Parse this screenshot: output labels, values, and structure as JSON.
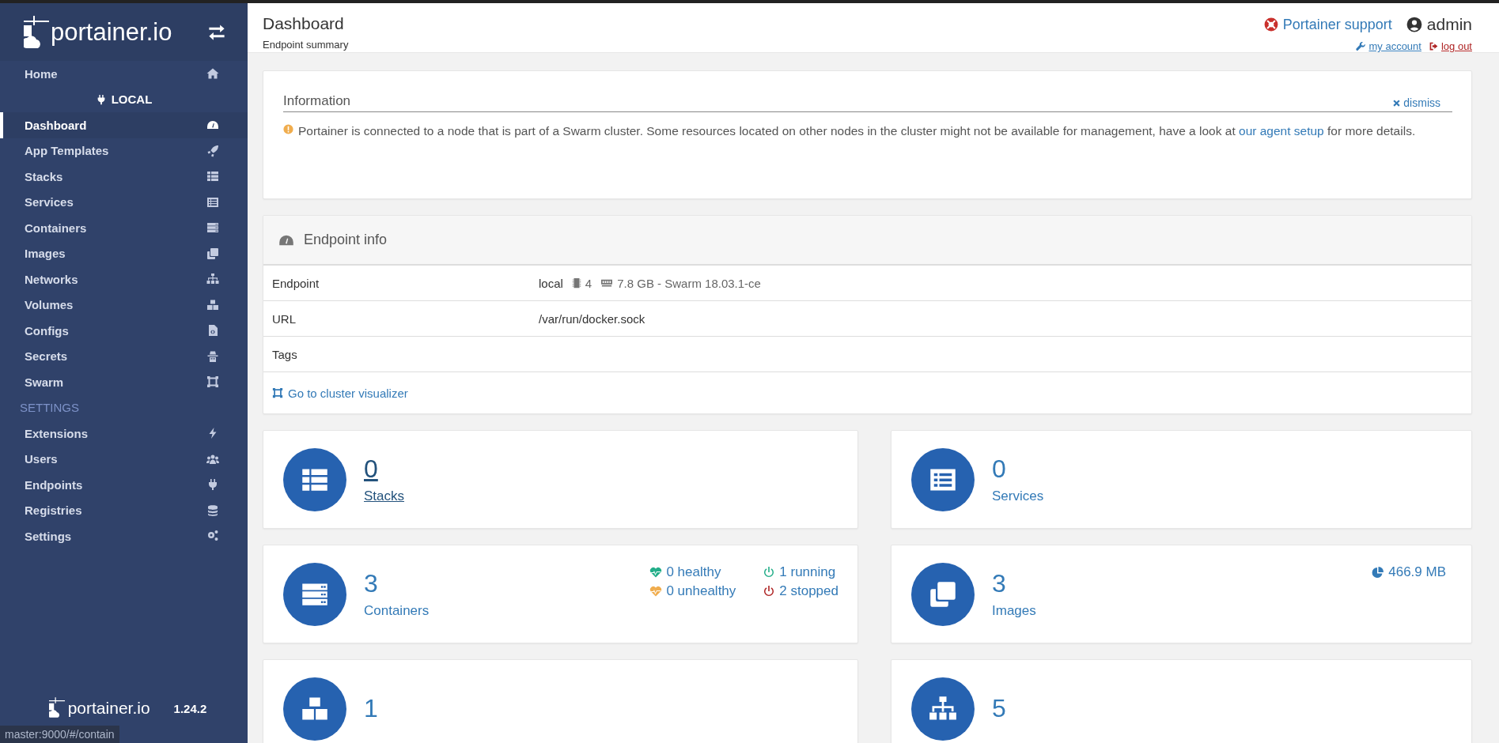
{
  "sidebar": {
    "brand": "portainer.io",
    "items": [
      {
        "kind": "link",
        "label": "Home",
        "selected": false
      },
      {
        "kind": "endpoint",
        "label": "LOCAL"
      },
      {
        "kind": "link",
        "label": "Dashboard",
        "selected": true
      },
      {
        "kind": "link",
        "label": "App Templates",
        "selected": false
      },
      {
        "kind": "link",
        "label": "Stacks",
        "selected": false
      },
      {
        "kind": "link",
        "label": "Services",
        "selected": false
      },
      {
        "kind": "link",
        "label": "Containers",
        "selected": false
      },
      {
        "kind": "link",
        "label": "Images",
        "selected": false
      },
      {
        "kind": "link",
        "label": "Networks",
        "selected": false
      },
      {
        "kind": "link",
        "label": "Volumes",
        "selected": false
      },
      {
        "kind": "link",
        "label": "Configs",
        "selected": false
      },
      {
        "kind": "link",
        "label": "Secrets",
        "selected": false
      },
      {
        "kind": "link",
        "label": "Swarm",
        "selected": false
      },
      {
        "kind": "section",
        "label": "SETTINGS"
      },
      {
        "kind": "link",
        "label": "Extensions",
        "selected": false
      },
      {
        "kind": "link",
        "label": "Users",
        "selected": false
      },
      {
        "kind": "link",
        "label": "Endpoints",
        "selected": false
      },
      {
        "kind": "link",
        "label": "Registries",
        "selected": false
      },
      {
        "kind": "link",
        "label": "Settings",
        "selected": false
      }
    ],
    "footer": {
      "brand": "portainer.io",
      "version": "1.24.2"
    }
  },
  "header": {
    "title": "Dashboard",
    "subtitle": "Endpoint summary",
    "support": "Portainer support",
    "user": "admin",
    "my_account": "my account",
    "log_out": "log out"
  },
  "information": {
    "title": "Information",
    "dismiss": "dismiss",
    "text_before": "Portainer is connected to a node that is part of a Swarm cluster. Some resources located on other nodes in the cluster might not be available for management, have a look at ",
    "link": "our agent setup",
    "text_after": " for more details."
  },
  "endpoint_info": {
    "title": "Endpoint info",
    "rows": [
      {
        "kind": "endpoint",
        "label": "Endpoint",
        "name": "local",
        "cpu": "4",
        "memory": "7.8 GB - Swarm 18.03.1-ce"
      },
      {
        "kind": "text",
        "label": "URL",
        "value": "/var/run/docker.sock"
      },
      {
        "kind": "text",
        "label": "Tags"
      }
    ],
    "link": "Go to cluster visualizer"
  },
  "stats": [
    {
      "kind": "stacks",
      "count": "0",
      "label": "Stacks",
      "hovered": true
    },
    {
      "kind": "services",
      "count": "0",
      "label": "Services",
      "hovered": false
    },
    {
      "kind": "containers",
      "count": "3",
      "label": "Containers",
      "hovered": false,
      "details": [
        {
          "kind": "healthy",
          "text": "0 healthy"
        },
        {
          "kind": "running",
          "text": "1 running"
        },
        {
          "kind": "unhealthy",
          "text": "0 unhealthy"
        },
        {
          "kind": "stopped",
          "text": "2 stopped"
        }
      ]
    },
    {
      "kind": "images",
      "count": "3",
      "label": "Images",
      "hovered": false,
      "size": "466.9 MB"
    },
    {
      "kind": "volumes",
      "count": "1",
      "hovered": false
    },
    {
      "kind": "networks",
      "count": "5",
      "hovered": false
    }
  ],
  "status_bar": "master:9000/#/contain"
}
